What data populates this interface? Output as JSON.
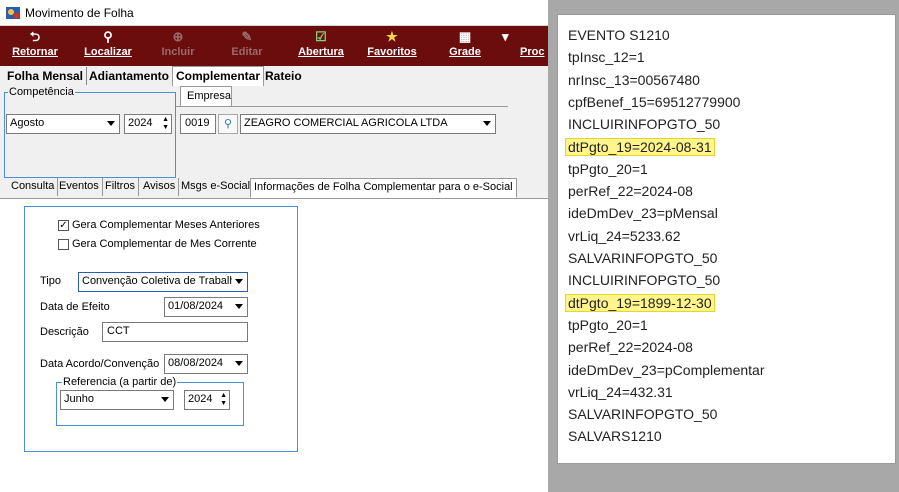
{
  "window": {
    "title": "Movimento de Folha"
  },
  "toolbar": [
    {
      "label": "Retornar",
      "icon": "⮌",
      "enabled": true
    },
    {
      "label": "Localizar",
      "icon": "🔍",
      "enabled": true
    },
    {
      "label": "Incluir",
      "icon": "⊕",
      "enabled": false
    },
    {
      "label": "Editar",
      "icon": "✎",
      "enabled": false
    },
    {
      "label": "Abertura",
      "icon": "☑",
      "enabled": true
    },
    {
      "label": "Favoritos",
      "icon": "★",
      "enabled": true
    },
    {
      "label": "Grade",
      "icon": "▦",
      "enabled": true
    },
    {
      "label": "Proc",
      "icon": "▾",
      "enabled": true
    }
  ],
  "main_tabs": [
    "Folha Mensal",
    "Adiantamento",
    "Complementar",
    "Rateio"
  ],
  "active_main_tab": "Complementar",
  "competencia": {
    "legend": "Competência",
    "month": "Agosto",
    "year": "2024"
  },
  "empresa": {
    "tab_label": "Empresa",
    "code": "0019",
    "name": "ZEAGRO COMERCIAL AGRICOLA LTDA"
  },
  "sub_tabs": [
    "Consulta",
    "Eventos",
    "Filtros",
    "Avisos",
    "Msgs e-Social",
    "Informações de Folha Complementar para o e-Social"
  ],
  "form": {
    "chk_anteriores": "Gera Complementar Meses Anteriores",
    "chk_anteriores_checked": true,
    "chk_corrente": "Gera Complementar de Mes Corrente",
    "chk_corrente_checked": false,
    "tipo_label": "Tipo",
    "tipo_value": "Convenção Coletiva de Trabalho",
    "data_efeito_label": "Data de Efeito",
    "data_efeito_value": "01/08/2024",
    "descricao_label": "Descrição",
    "descricao_value": "CCT",
    "data_acordo_label": "Data Acordo/Convenção",
    "data_acordo_value": "08/08/2024",
    "referencia_legend": "Referencia (a partir de)",
    "referencia_month": "Junho",
    "referencia_year": "2024"
  },
  "log_lines": [
    {
      "text": "EVENTO S1210",
      "highlight": false
    },
    {
      "text": "tpInsc_12=1",
      "highlight": false
    },
    {
      "text": "nrInsc_13=00567480",
      "highlight": false
    },
    {
      "text": "cpfBenef_15=69512779900",
      "highlight": false
    },
    {
      "text": "INCLUIRINFOPGTO_50",
      "highlight": false
    },
    {
      "text": "dtPgto_19=2024-08-31",
      "highlight": true
    },
    {
      "text": "tpPgto_20=1",
      "highlight": false
    },
    {
      "text": "perRef_22=2024-08",
      "highlight": false
    },
    {
      "text": "ideDmDev_23=pMensal",
      "highlight": false
    },
    {
      "text": "vrLiq_24=5233.62",
      "highlight": false
    },
    {
      "text": "SALVARINFOPGTO_50",
      "highlight": false
    },
    {
      "text": "INCLUIRINFOPGTO_50",
      "highlight": false
    },
    {
      "text": "dtPgto_19=1899-12-30",
      "highlight": true
    },
    {
      "text": "tpPgto_20=1",
      "highlight": false
    },
    {
      "text": "perRef_22=2024-08",
      "highlight": false
    },
    {
      "text": "ideDmDev_23=pComplementar",
      "highlight": false
    },
    {
      "text": "vrLiq_24=432.31",
      "highlight": false
    },
    {
      "text": "SALVARINFOPGTO_50",
      "highlight": false
    },
    {
      "text": "SALVARS1210",
      "highlight": false
    }
  ],
  "colors": {
    "toolbar_bg": "#6b0d0d",
    "accent_border": "#4a90d9",
    "highlight": "#fff58a"
  }
}
